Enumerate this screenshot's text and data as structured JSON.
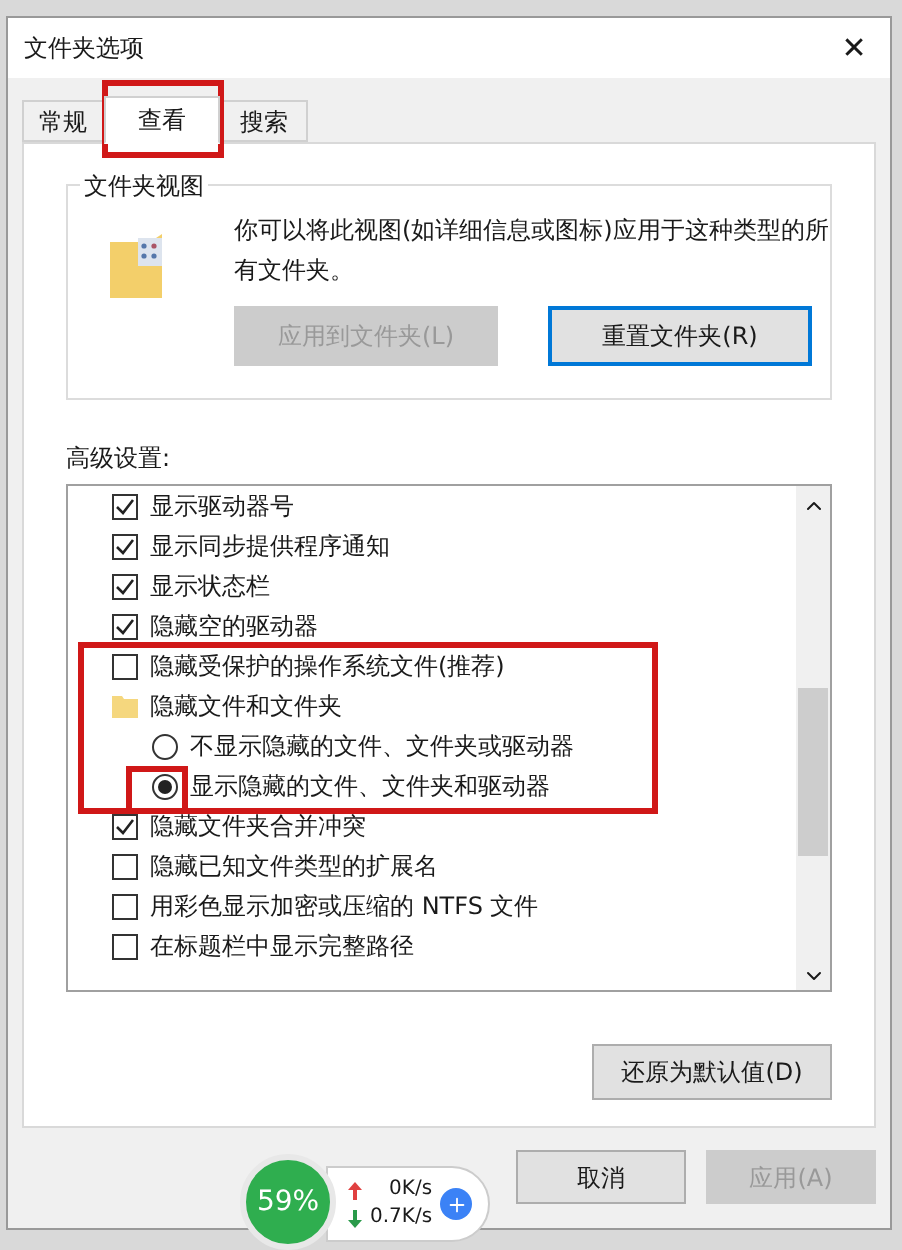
{
  "window": {
    "title": "文件夹选项",
    "close": "✕"
  },
  "tabs": [
    {
      "label": "常规",
      "selected": false
    },
    {
      "label": "查看",
      "selected": true
    },
    {
      "label": "搜索",
      "selected": false
    }
  ],
  "folder_views": {
    "title": "文件夹视图",
    "description": "你可以将此视图(如详细信息或图标)应用于这种类型的所有文件夹。",
    "buttons": [
      {
        "label": "应用到文件夹(L)",
        "disabled": true
      },
      {
        "label": "重置文件夹(R)",
        "disabled": false
      }
    ]
  },
  "advanced": {
    "label": "高级设置:",
    "items": [
      {
        "kind": "checkbox",
        "label": "显示驱动器号",
        "checked": true
      },
      {
        "kind": "checkbox",
        "label": "显示同步提供程序通知",
        "checked": true
      },
      {
        "kind": "checkbox",
        "label": "显示状态栏",
        "checked": true
      },
      {
        "kind": "checkbox",
        "label": "隐藏空的驱动器",
        "checked": true
      },
      {
        "kind": "checkbox",
        "label": "隐藏受保护的操作系统文件(推荐)",
        "checked": false
      },
      {
        "kind": "folder",
        "label": "隐藏文件和文件夹",
        "children": [
          {
            "kind": "radio",
            "label": "不显示隐藏的文件、文件夹或驱动器",
            "selected": false
          },
          {
            "kind": "radio",
            "label": "显示隐藏的文件、文件夹和驱动器",
            "selected": true
          }
        ]
      },
      {
        "kind": "checkbox",
        "label": "隐藏文件夹合并冲突",
        "checked": true
      },
      {
        "kind": "checkbox",
        "label": "隐藏已知文件类型的扩展名",
        "checked": false
      },
      {
        "kind": "checkbox",
        "label": "用彩色显示加密或压缩的 NTFS 文件",
        "checked": false
      },
      {
        "kind": "checkbox",
        "label": "在标题栏中显示完整路径",
        "checked": false
      }
    ],
    "restore_button": "还原为默认值(D)"
  },
  "footer_buttons": [
    {
      "label": "取消",
      "disabled": false
    },
    {
      "label": "应用(A)",
      "disabled": true
    }
  ],
  "speed_widget": {
    "percent": "59%",
    "upload": "0K/s",
    "download": "0.7K/s"
  }
}
